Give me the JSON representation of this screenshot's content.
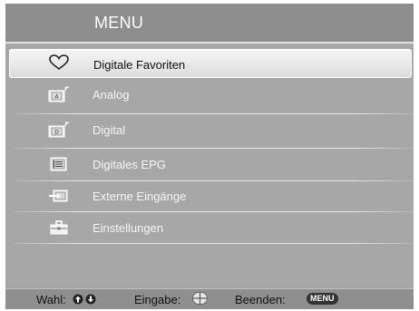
{
  "menu": {
    "title": "MENU",
    "items": [
      {
        "label": "Digitale Favoriten",
        "icon": "heart-icon",
        "selected": true
      },
      {
        "label": "Analog",
        "icon": "analog-tv-icon",
        "icon_letter": "A"
      },
      {
        "label": "Digital",
        "icon": "digital-tv-icon",
        "icon_letter": "D"
      },
      {
        "label": "Digitales EPG",
        "icon": "epg-guide-icon"
      },
      {
        "label": "Externe Eingänge",
        "icon": "external-input-icon"
      },
      {
        "label": "Einstellungen",
        "icon": "settings-toolbox-icon"
      }
    ]
  },
  "footer": {
    "select_label": "Wahl:",
    "enter_label": "Eingabe:",
    "exit_label": "Beenden:",
    "exit_key": "MENU"
  },
  "colors": {
    "background": "#a7a7a7",
    "title_bar": "#8d8d8d",
    "selected_item": "#e8e8e8",
    "text_light": "#f5f5f5",
    "text_dark": "#111111"
  }
}
